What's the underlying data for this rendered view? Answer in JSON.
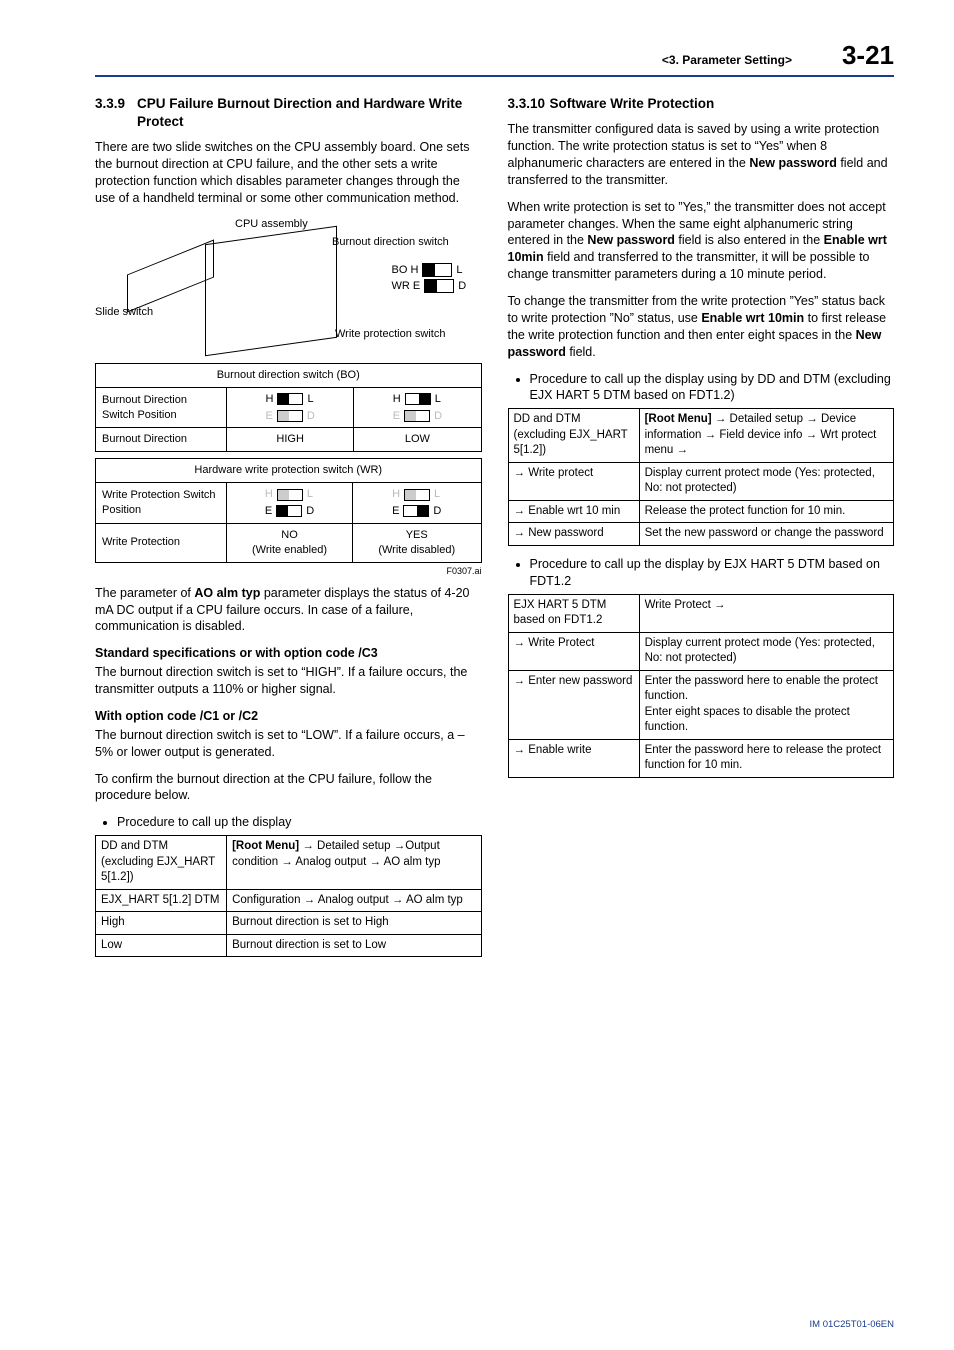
{
  "header": {
    "crumb": "<3.  Parameter Setting>",
    "page": "3-21"
  },
  "left": {
    "sec_num": "3.3.9",
    "sec_title": "CPU Failure Burnout Direction and Hardware Write Protect",
    "intro": "There are two slide switches on the CPU assembly board. One sets the burnout direction at CPU failure, and the other sets a write protection function which disables parameter changes through the use of a handheld terminal or some other communication method.",
    "diag": {
      "cpu_assembly": "CPU assembly",
      "burnout_switch": "Burnout direction switch",
      "write_switch": "Write protection switch",
      "slide_switch": "Slide switch",
      "bo_h": "BO H",
      "wr_e": "WR E",
      "l": "L",
      "d": "D"
    },
    "bo_table": {
      "title": "Burnout direction switch (BO)",
      "row1_label": "Burnout Direction Switch Position",
      "h": "H",
      "e": "E",
      "l": "L",
      "d": "D",
      "row2_label": "Burnout Direction",
      "high": "HIGH",
      "low": "LOW"
    },
    "wr_table": {
      "title": "Hardware write protection switch (WR)",
      "row1_label": "Write Protection Switch Position",
      "row2_label": "Write Protection",
      "no": "NO",
      "no_sub": "(Write enabled)",
      "yes": "YES",
      "yes_sub": "(Write disabled)"
    },
    "fig_caption": "F0307.ai",
    "para_ao_1": "The parameter of ",
    "para_ao_bold": "AO alm typ",
    "para_ao_2": " parameter displays the status of 4-20 mA DC output if a CPU failure occurs. In case of a failure, communication is disabled.",
    "std_head": "Standard specifications or with option code /C3",
    "std_body": "The burnout direction switch is set to “HIGH”. If a failure occurs, the transmitter outputs a 110% or higher signal.",
    "opt_head": "With option code /C1 or /C2",
    "opt_body": "The burnout direction switch is set to “LOW”. If a failure occurs, a –5% or lower output is generated.",
    "confirm": "To confirm the burnout direction at the CPU failure, follow the procedure below.",
    "bul1": "Procedure to call up the display",
    "proc1": {
      "r1a": "DD and DTM (excluding EJX_HART 5[1.2])",
      "r1b_b": "[Root Menu]",
      "r1b_rest": " → Detailed setup →Output condition → Analog output → AO alm typ",
      "r2a": "EJX_HART 5[1.2] DTM",
      "r2b": "Configuration → Analog output → AO alm typ",
      "r3a": "High",
      "r3b": "Burnout direction is set to High",
      "r4a": "Low",
      "r4b": "Burnout direction is set to Low"
    }
  },
  "right": {
    "sec_num": "3.3.10",
    "sec_title": "Software Write Protection",
    "p1_a": "The transmitter configured data is saved by using a write protection function. The write protection status is set to “Yes” when 8 alphanumeric characters are entered in the ",
    "p1_b": "New password",
    "p1_c": " field and transferred to the transmitter.",
    "p2_a": "When write protection is set to ”Yes,” the transmitter does not accept parameter changes. When the same eight alphanumeric string entered in the ",
    "p2_b": "New password",
    "p2_c": " field is also entered in the ",
    "p2_d": "Enable wrt 10min",
    "p2_e": " field and transferred to the transmitter, it will be possible to change transmitter parameters during a 10 minute period.",
    "p3_a": "To change the transmitter from the write protection ”Yes” status back to write protection ”No” status, use ",
    "p3_b": "Enable wrt 10min",
    "p3_c": " to first release the write protection function and then enter eight spaces in the ",
    "p3_d": "New password",
    "p3_e": " field.",
    "bul1": "Procedure to call up the display using by DD and DTM (excluding EJX HART 5 DTM based on FDT1.2)",
    "t1": {
      "r1a": "DD and DTM (excluding EJX_HART 5[1.2])",
      "r1b_b": "[Root Menu]",
      "r1b_rest": " → Detailed setup → Device information → Field device info → Wrt protect menu →",
      "r2a": "→ Write protect",
      "r2b": "Display current protect mode (Yes: protected, No: not protected)",
      "r3a": "→ Enable wrt 10 min",
      "r3b": "Release the protect function for 10 min.",
      "r4a": "→ New password",
      "r4b": "Set the new password or change the password"
    },
    "bul2": "Procedure to call up the display by EJX HART 5 DTM based on FDT1.2",
    "t2": {
      "r1a": "EJX HART 5 DTM based on FDT1.2",
      "r1b": "Write Protect →",
      "r2a": "→ Write Protect",
      "r2b": "Display current protect mode (Yes: protected, No: not protected)",
      "r3a": "→ Enter new password",
      "r3b": "Enter the password here to enable the protect function.\nEnter eight spaces to disable the protect function.",
      "r4a": "→ Enable write",
      "r4b": "Enter the password here to release the protect function for 10 min."
    }
  },
  "footer": "IM 01C25T01-06EN"
}
